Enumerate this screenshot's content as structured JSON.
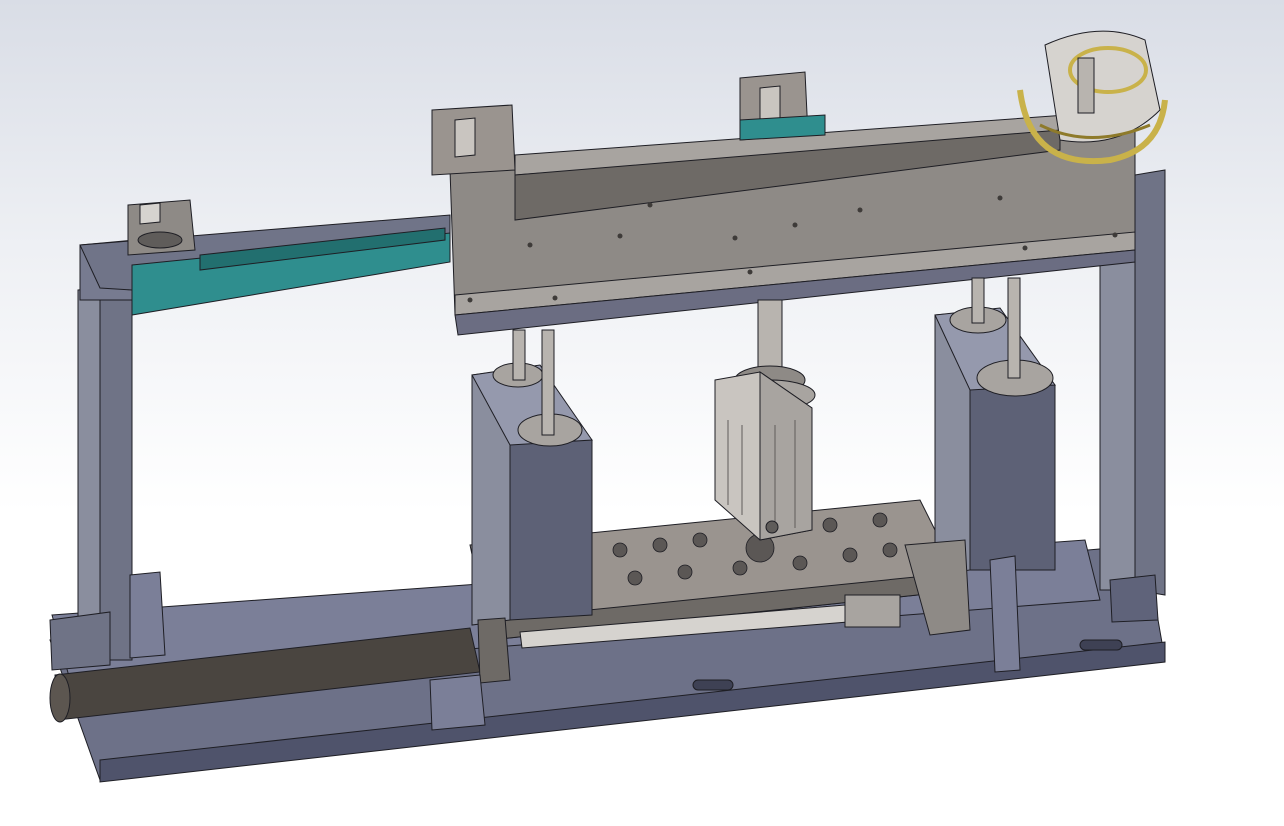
{
  "scene": {
    "kind": "cad-3d-assembly-view",
    "background_top": "#d9dde6",
    "background_bottom": "#ffffff"
  },
  "palette": {
    "body_gray": "#8e8a86",
    "body_gray_light": "#a8a4a0",
    "body_gray_dark": "#5f5c5a",
    "steel_blue": "#7b7f98",
    "steel_blue_dark": "#4f536b",
    "teal_rail": "#2f8e8e",
    "gold_part": "#c9b24a",
    "rod_dark": "#4a4540",
    "edge": "#1e1e24"
  },
  "parts": {
    "top_plate": "top-plate",
    "left_frame": "left-frame-column",
    "right_frame": "right-frame-column",
    "base_plate": "base-plate",
    "left_guide_block": "left-guide-block",
    "right_guide_block": "right-guide-block",
    "center_cylinder": "center-air-cylinder",
    "gripper": "gripper-head",
    "bottom_rod": "bottom-rod-cylinder"
  }
}
